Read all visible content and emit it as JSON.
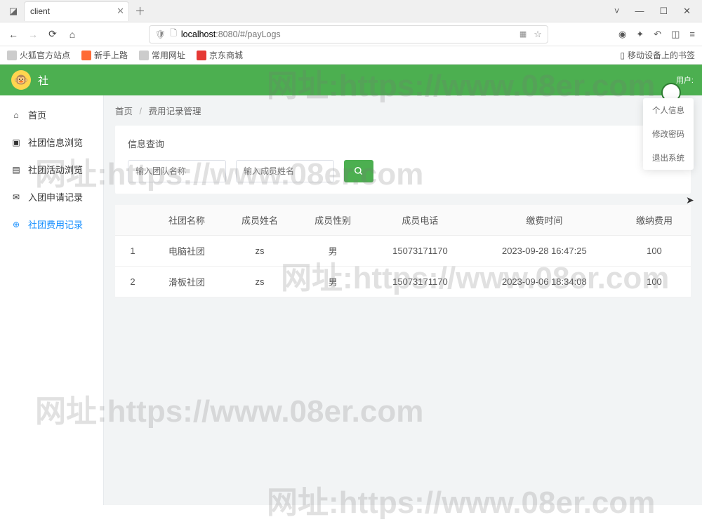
{
  "browser": {
    "tab_title": "client",
    "url_host": "localhost",
    "url_port": ":8080",
    "url_path": "/#/payLogs",
    "win": {
      "chevron": "˅",
      "min": "―",
      "max": "☐",
      "close": "✕"
    },
    "nav": {
      "back": "←",
      "fwd": "→",
      "reload": "⟳",
      "home": "⌂"
    }
  },
  "bookmarks": {
    "b1": "火狐官方站点",
    "b2": "新手上路",
    "b3": "常用网址",
    "b4": "京东商城",
    "right": "移动设备上的书签"
  },
  "app": {
    "title": "社",
    "user_label": "用户:"
  },
  "sidebar": {
    "items": [
      "首页",
      "社团信息浏览",
      "社团活动浏览",
      "入团申请记录",
      "社团费用记录"
    ],
    "icons": [
      "⌂",
      "▣",
      "▤",
      "✉",
      "⊕"
    ]
  },
  "breadcrumb": {
    "a": "首页",
    "b": "费用记录管理"
  },
  "search": {
    "panel_title": "信息查询",
    "ph1": "输入团队名称",
    "ph2": "输入成员姓名"
  },
  "table": {
    "headers": [
      "",
      "社团名称",
      "成员姓名",
      "成员性别",
      "成员电话",
      "缴费时间",
      "缴纳费用"
    ],
    "rows": [
      {
        "idx": "1",
        "club": "电脑社团",
        "name": "zs",
        "gender": "男",
        "phone": "15073171170",
        "time": "2023-09-28 16:47:25",
        "fee": "100"
      },
      {
        "idx": "2",
        "club": "滑板社团",
        "name": "zs",
        "gender": "男",
        "phone": "15073171170",
        "time": "2023-09-06 18:34:08",
        "fee": "100"
      }
    ]
  },
  "dropdown": {
    "i1": "个人信息",
    "i2": "修改密码",
    "i3": "退出系统"
  },
  "watermark": "网址:https://www.08er.com"
}
